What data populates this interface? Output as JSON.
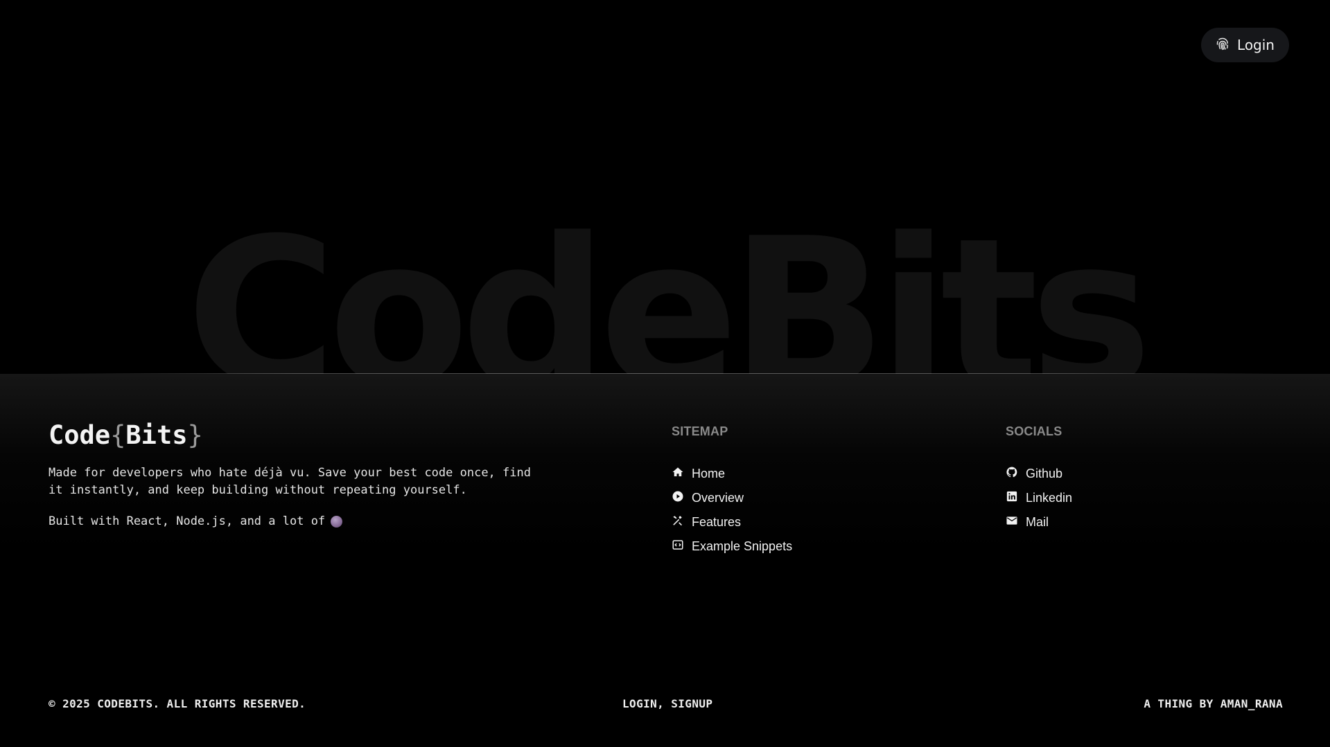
{
  "header": {
    "login_label": "Login",
    "login_icon": "fingerprint-icon"
  },
  "watermark": {
    "text": "CodeBits"
  },
  "brand": {
    "logo_left": "Code",
    "logo_brace_open": "{",
    "logo_mid": "Bits",
    "logo_brace_close": "}",
    "description": "Made for developers who hate déjà vu. Save your best code once, find it instantly, and keep building without repeating yourself.",
    "built_with": "Built with React, Node.js, and a lot of",
    "built_icon": "coffee-icon"
  },
  "sitemap": {
    "title": "SITEMAP",
    "items": [
      {
        "label": "Home",
        "icon": "home-icon"
      },
      {
        "label": "Overview",
        "icon": "play-circle-icon"
      },
      {
        "label": "Features",
        "icon": "tools-icon"
      },
      {
        "label": "Example Snippets",
        "icon": "code-window-icon"
      }
    ]
  },
  "socials": {
    "title": "SOCIALS",
    "items": [
      {
        "label": "Github",
        "icon": "github-icon"
      },
      {
        "label": "Linkedin",
        "icon": "linkedin-icon"
      },
      {
        "label": "Mail",
        "icon": "mail-icon"
      }
    ]
  },
  "footer": {
    "copyright": "© 2025 CODEBITS. ALL RIGHTS RESERVED.",
    "auth_links": "LOGIN, SIGNUP",
    "credit": "A THING BY AMAN_RANA"
  }
}
